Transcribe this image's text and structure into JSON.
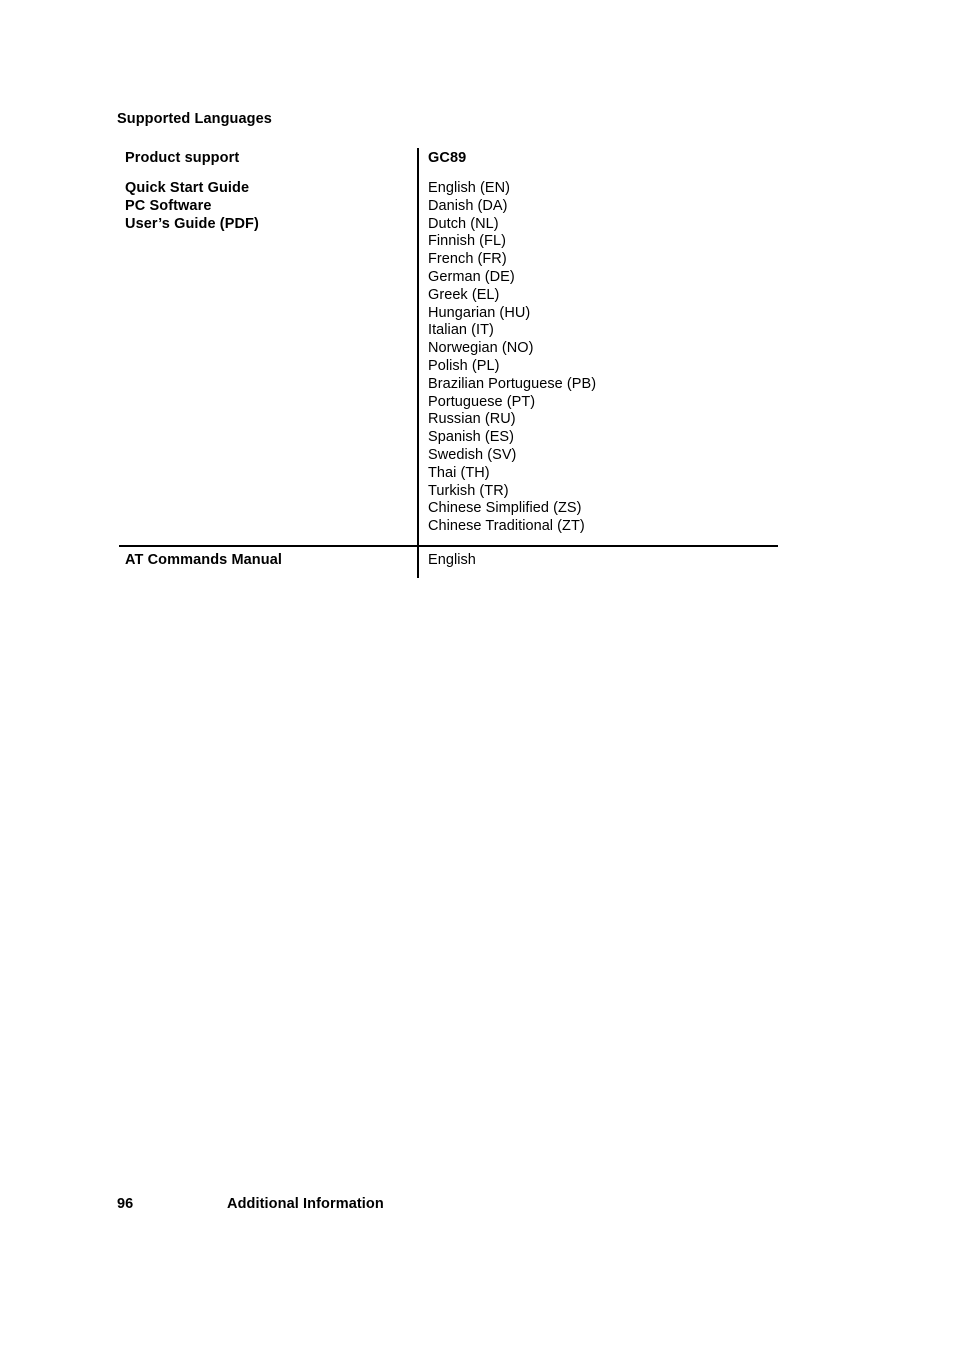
{
  "section": {
    "heading": "Supported Languages"
  },
  "table": {
    "header": {
      "left": "Product support",
      "right": "GC89"
    },
    "documents_row": {
      "left_lines": [
        "Quick Start Guide",
        "PC Software",
        "User’s Guide (PDF)"
      ],
      "languages": [
        "English (EN)",
        "Danish (DA)",
        "Dutch (NL)",
        "Finnish (FL)",
        "French (FR)",
        "German (DE)",
        "Greek (EL)",
        "Hungarian (HU)",
        "Italian (IT)",
        "Norwegian (NO)",
        "Polish (PL)",
        "Brazilian Portuguese (PB)",
        "Portuguese (PT)",
        "Russian (RU)",
        "Spanish (ES)",
        "Swedish (SV)",
        "Thai (TH)",
        "Turkish (TR)",
        "Chinese Simplified (ZS)",
        "Chinese Traditional (ZT)"
      ]
    },
    "at_commands_row": {
      "left": "AT Commands Manual",
      "right": "English"
    }
  },
  "footer": {
    "page_number": "96",
    "chapter_title": "Additional Information"
  }
}
